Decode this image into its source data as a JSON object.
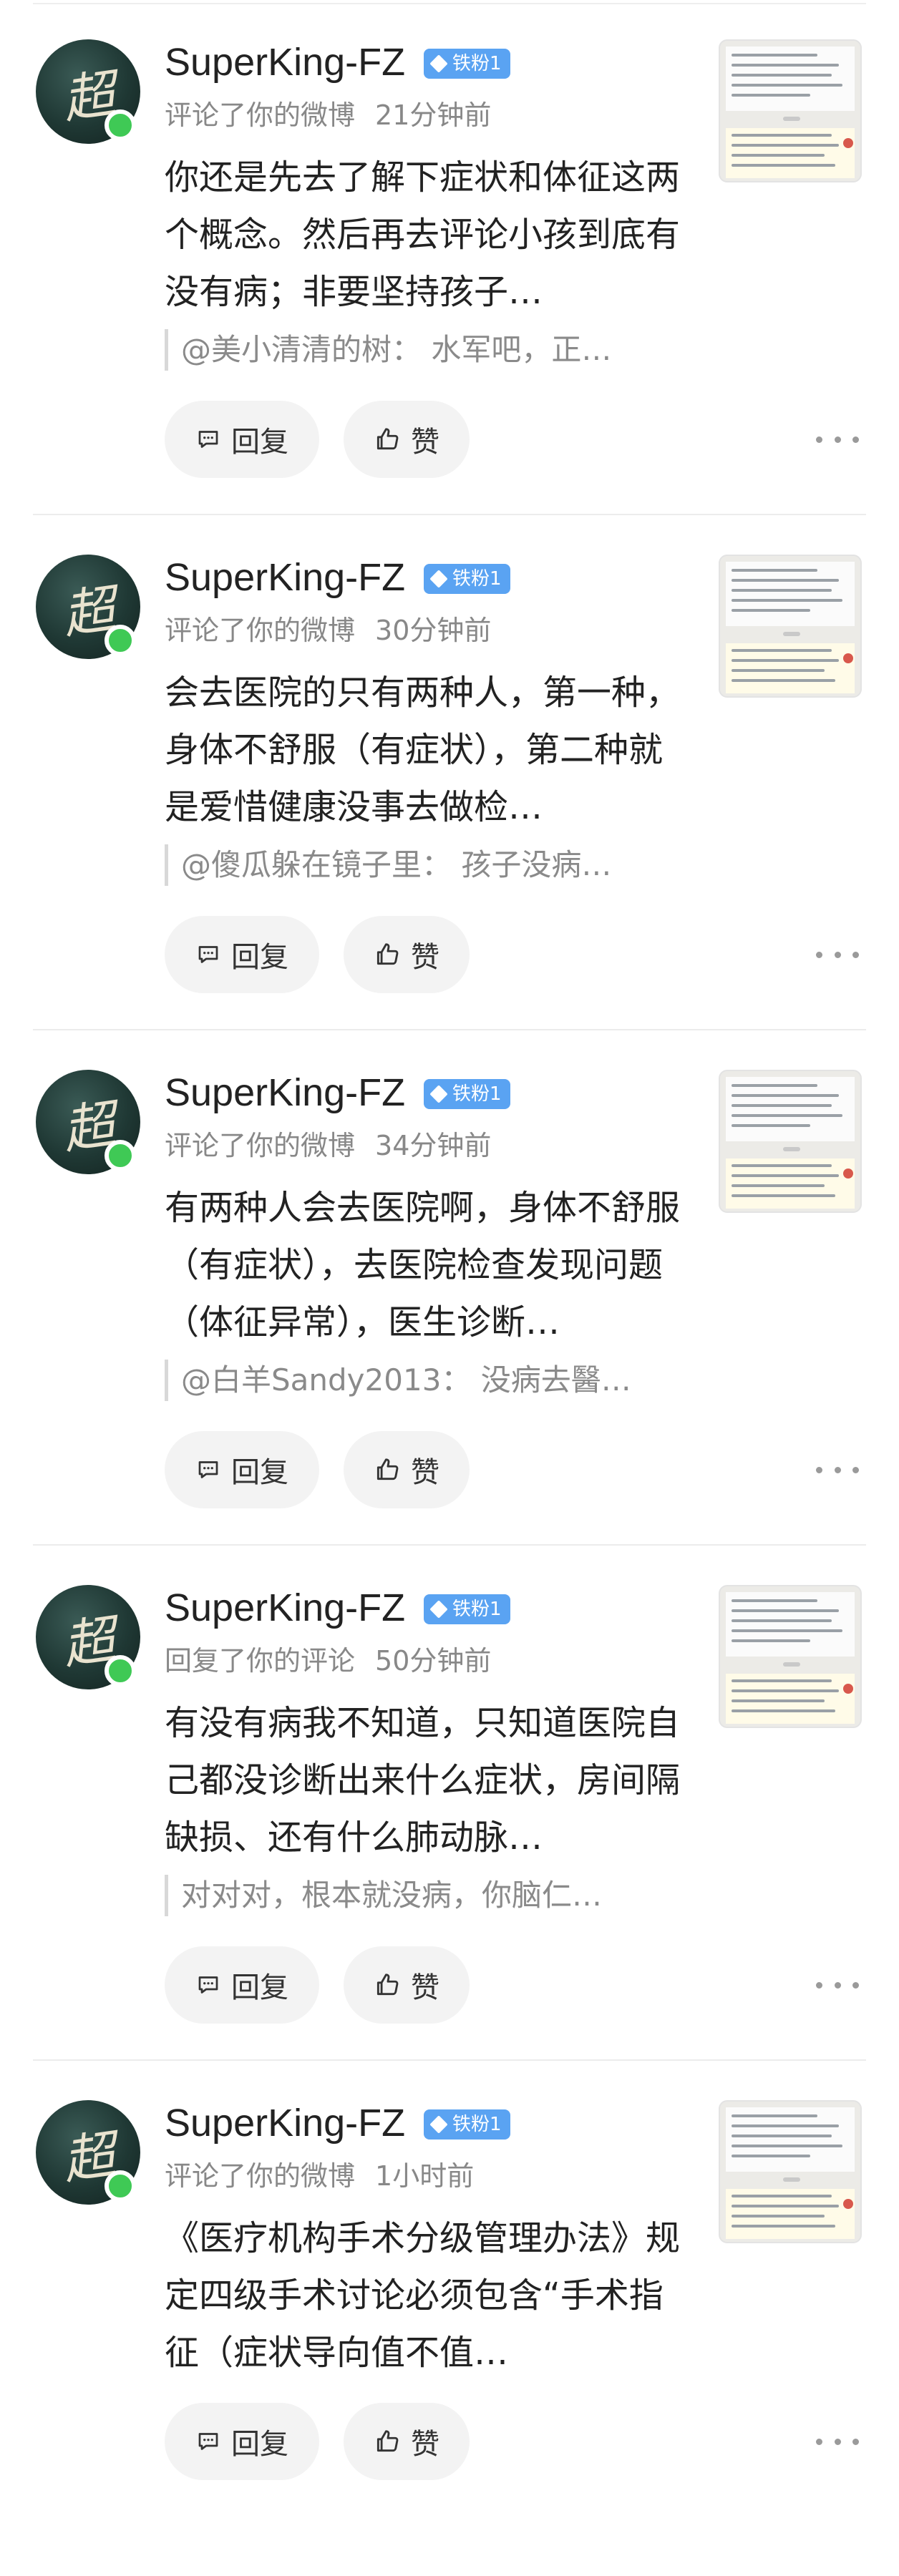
{
  "feed": {
    "items": [
      {
        "username": "SuperKing-FZ",
        "badge": "铁粉1",
        "action": "评论了你的微博",
        "time": "21分钟前",
        "content": "你还是先去了解下症状和体征这两个概念。然后再去评论小孩到底有没有病；非要坚持孩子…",
        "quote": "@美小清清的树：  水军吧，正…",
        "reply_label": "回复",
        "like_label": "赞"
      },
      {
        "username": "SuperKing-FZ",
        "badge": "铁粉1",
        "action": "评论了你的微博",
        "time": "30分钟前",
        "content": "会去医院的只有两种人，第一种，身体不舒服（有症状），第二种就是爱惜健康没事去做检…",
        "quote": "@傻瓜躲在镜子里：  孩子没病…",
        "reply_label": "回复",
        "like_label": "赞"
      },
      {
        "username": "SuperKing-FZ",
        "badge": "铁粉1",
        "action": "评论了你的微博",
        "time": "34分钟前",
        "content": "有两种人会去医院啊，身体不舒服（有症状），去医院检查发现问题（体征异常），医生诊断…",
        "quote": "@白羊Sandy2013：  没病去醫…",
        "reply_label": "回复",
        "like_label": "赞"
      },
      {
        "username": "SuperKing-FZ",
        "badge": "铁粉1",
        "action": "回复了你的评论",
        "time": "50分钟前",
        "content": "有没有病我不知道，只知道医院自己都没诊断出来什么症状，房间隔缺损、还有什么肺动脉…",
        "quote": "对对对，根本就没病，你脑仁…",
        "reply_label": "回复",
        "like_label": "赞"
      },
      {
        "username": "SuperKing-FZ",
        "badge": "铁粉1",
        "action": "评论了你的微博",
        "time": "1小时前",
        "content": "《医疗机构手术分级管理办法》规定四级手术讨论必须包含“手术指征（症状导向值不值…",
        "quote": "",
        "reply_label": "回复",
        "like_label": "赞"
      }
    ],
    "avatar_glyph": "超",
    "colors": {
      "badge": "#5aa3f2",
      "online": "#3fc955",
      "meta": "#888888",
      "button_bg": "#f3f3f3"
    },
    "icons": {
      "reply": "comment-bubble-icon",
      "like": "thumbs-up-icon",
      "more": "more-dots-icon"
    }
  }
}
